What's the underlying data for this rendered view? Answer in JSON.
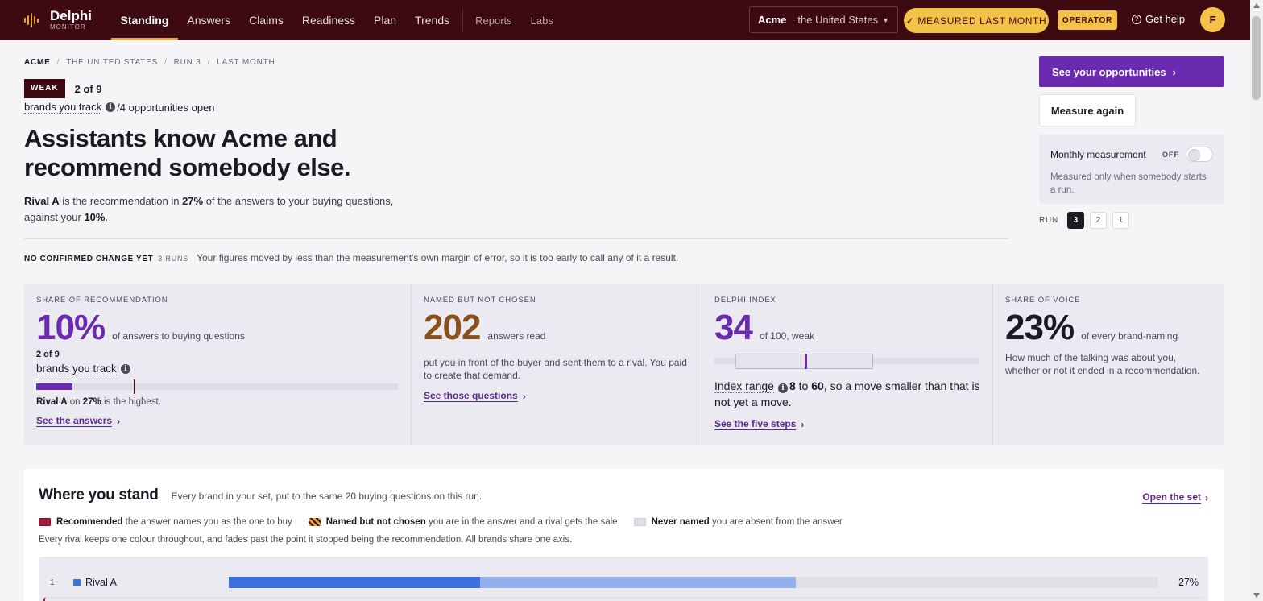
{
  "app": {
    "name": "Delphi",
    "subtitle": "MONITOR"
  },
  "nav": {
    "items": [
      {
        "label": "Standing",
        "active": true
      },
      {
        "label": "Answers"
      },
      {
        "label": "Claims"
      },
      {
        "label": "Readiness"
      },
      {
        "label": "Plan"
      },
      {
        "label": "Trends"
      }
    ],
    "secondary": [
      {
        "label": "Reports"
      },
      {
        "label": "Labs"
      }
    ]
  },
  "header": {
    "brand": "Acme",
    "market": "· the United States",
    "measured": "✓ MEASURED LAST MONTH",
    "role": "OPERATOR",
    "help": "Get help",
    "avatar_initial": "F"
  },
  "breadcrumb": [
    "ACME",
    "THE UNITED STATES",
    "RUN 3",
    "LAST MONTH"
  ],
  "verdict": {
    "badge": "WEAK",
    "rank": "2 of 9",
    "track_label": "brands you track",
    "opps": "/4 opportunities open"
  },
  "headline": "Assistants know Acme and recommend somebody else.",
  "summary": {
    "rival": "Rival A",
    "mid1": " is the recommendation in ",
    "rival_pct": "27%",
    "mid2": " of the answers to your buying questions, against your ",
    "own_pct": "10%",
    "end": "."
  },
  "change": {
    "label": "NO CONFIRMED CHANGE YET",
    "runs": "3 RUNS",
    "text": "Your figures moved by less than the measurement's own margin of error, so it is too early to call any of it a result."
  },
  "actions": {
    "opportunities": "See your opportunities",
    "measure_again": "Measure again",
    "monthly_label": "Monthly measurement",
    "monthly_state": "OFF",
    "monthly_desc": "Measured only when somebody starts a run.",
    "run_label": "RUN",
    "runs": [
      "3",
      "2",
      "1"
    ]
  },
  "metrics": {
    "sor": {
      "label": "SHARE OF RECOMMENDATION",
      "value": "10%",
      "unit": "of answers to buying questions",
      "rank": "2 of 9",
      "track_label": "brands you track",
      "own_fraction": 0.1,
      "leader_fraction": 0.27,
      "leader_name": "Rival A",
      "leader_on": " on ",
      "leader_pct": "27%",
      "leader_tail": " is the highest.",
      "link": "See the answers"
    },
    "named": {
      "label": "NAMED BUT NOT CHOSEN",
      "value": "202",
      "unit": "answers read",
      "desc": "put you in front of the buyer and sent them to a rival. You paid to create that demand.",
      "link": "See those questions"
    },
    "index": {
      "label": "DELPHI INDEX",
      "value": "34",
      "unit": "of 100, weak",
      "score": 34,
      "range_low": 8,
      "range_high": 60,
      "range_label": "Index range",
      "range_low_text": "8",
      "range_to": " to ",
      "range_high_text": "60",
      "range_tail": ", so a move smaller than that is not yet a move.",
      "link": "See the five steps"
    },
    "sov": {
      "label": "SHARE OF VOICE",
      "value": "23%",
      "unit": "of every brand-naming",
      "desc": "How much of the talking was about you, whether or not it ended in a recommendation."
    }
  },
  "stand": {
    "title": "Where you stand",
    "subtitle": "Every brand in your set, put to the same 20 buying questions on this run.",
    "open_set": "Open the set",
    "legend": [
      {
        "key": "Recommended",
        "text": "the answer names you as the one to buy",
        "swatch": "rec"
      },
      {
        "key": "Named but not chosen",
        "text": "you are in the answer and a rival gets the sale",
        "swatch": "named"
      },
      {
        "key": "Never named",
        "text": "you are absent from the answer",
        "swatch": "never"
      }
    ],
    "note": "Every rival keeps one colour throughout, and fades past the point it stopped being the recommendation. All brands share one axis.",
    "rows": [
      {
        "rank": "1",
        "name": "Rival A",
        "pct": "27%",
        "recommended": 0.27,
        "named_end": 0.61,
        "color": "#3a6fdc"
      }
    ]
  },
  "colors": {
    "topbar": "#3d0a12",
    "accent": "#6a2bb0",
    "gold": "#f5c248",
    "brown": "#8a4f1a"
  }
}
